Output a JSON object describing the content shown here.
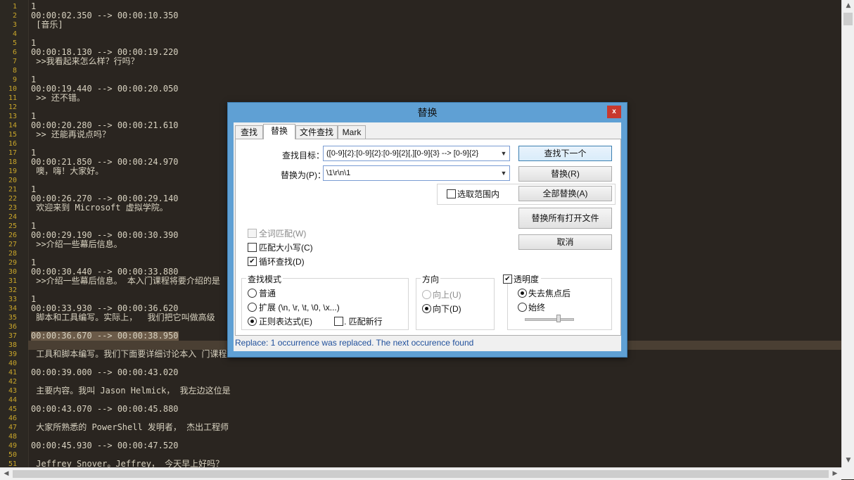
{
  "editor": {
    "lines": [
      {
        "n": "1",
        "text": "1"
      },
      {
        "n": "2",
        "text": "00:00:02.350 --> 00:00:10.350"
      },
      {
        "n": "3",
        "text": " [音乐]"
      },
      {
        "n": "4",
        "text": ""
      },
      {
        "n": "5",
        "text": "1"
      },
      {
        "n": "6",
        "text": "00:00:18.130 --> 00:00:19.220"
      },
      {
        "n": "7",
        "text": " >>我看起来怎么样？行吗？"
      },
      {
        "n": "8",
        "text": ""
      },
      {
        "n": "9",
        "text": "1"
      },
      {
        "n": "10",
        "text": "00:00:19.440 --> 00:00:20.050"
      },
      {
        "n": "11",
        "text": " >> 还不错。"
      },
      {
        "n": "12",
        "text": ""
      },
      {
        "n": "13",
        "text": "1"
      },
      {
        "n": "14",
        "text": "00:00:20.280 --> 00:00:21.610"
      },
      {
        "n": "15",
        "text": " >> 还能再说点吗？"
      },
      {
        "n": "16",
        "text": ""
      },
      {
        "n": "17",
        "text": "1"
      },
      {
        "n": "18",
        "text": "00:00:21.850 --> 00:00:24.970"
      },
      {
        "n": "19",
        "text": " 噢，嗨！大家好。"
      },
      {
        "n": "20",
        "text": ""
      },
      {
        "n": "21",
        "text": "1"
      },
      {
        "n": "22",
        "text": "00:00:26.270 --> 00:00:29.140"
      },
      {
        "n": "23",
        "text": " 欢迎来到 Microsoft 虚拟学院。"
      },
      {
        "n": "24",
        "text": ""
      },
      {
        "n": "25",
        "text": "1"
      },
      {
        "n": "26",
        "text": "00:00:29.190 --> 00:00:30.390"
      },
      {
        "n": "27",
        "text": " >>介绍一些幕后信息。"
      },
      {
        "n": "28",
        "text": ""
      },
      {
        "n": "29",
        "text": "1"
      },
      {
        "n": "30",
        "text": "00:00:30.440 --> 00:00:33.880"
      },
      {
        "n": "31",
        "text": " >>介绍一些幕后信息。 本入门课程将要介绍的是"
      },
      {
        "n": "32",
        "text": ""
      },
      {
        "n": "33",
        "text": "1"
      },
      {
        "n": "34",
        "text": "00:00:33.930 --> 00:00:36.620"
      },
      {
        "n": "35",
        "text": " 脚本和工具编写。实际上，  我们把它叫做高级"
      },
      {
        "n": "36",
        "text": ""
      },
      {
        "n": "37",
        "text": "00:00:36.670 --> 00:00:38.950"
      },
      {
        "n": "38",
        "text": ""
      },
      {
        "n": "39",
        "text": " 工具和脚本编写。我们下面要详细讨论本入 门课程"
      },
      {
        "n": "40",
        "text": ""
      },
      {
        "n": "41",
        "text": "00:00:39.000 --> 00:00:43.020"
      },
      {
        "n": "42",
        "text": ""
      },
      {
        "n": "43",
        "text": " 主要内容。我叫 Jason Helmick， 我左边这位是"
      },
      {
        "n": "44",
        "text": ""
      },
      {
        "n": "45",
        "text": "00:00:43.070 --> 00:00:45.880"
      },
      {
        "n": "46",
        "text": ""
      },
      {
        "n": "47",
        "text": " 大家所熟悉的 PowerShell 发明者， 杰出工程师"
      },
      {
        "n": "48",
        "text": ""
      },
      {
        "n": "49",
        "text": "00:00:45.930 --> 00:00:47.520"
      },
      {
        "n": "50",
        "text": ""
      },
      {
        "n": "51",
        "text": " Jeffrey Snover。Jeffrey， 今天早上好吗？"
      }
    ]
  },
  "dialog": {
    "title": "替换",
    "close": "x",
    "tabs": [
      "查找",
      "替换",
      "文件查找",
      "Mark"
    ],
    "find_label": "查找目标：",
    "find_value": "([0-9]{2}:[0-9]{2}:[0-9]{2}[,][0-9]{3} --> [0-9]{2}",
    "replace_label": "替换为(P)：",
    "replace_value": "\\1\\r\\n\\1",
    "btn_find_next": "查找下一个",
    "btn_replace": "替换(R)",
    "in_selection": "选取范围内",
    "btn_replace_all": "全部替换(A)",
    "btn_replace_all_open": "替换所有打开文件",
    "btn_cancel": "取消",
    "opt_whole_word": "全词匹配(W)",
    "opt_match_case": "匹配大小写(C)",
    "opt_wrap": "循环查找(D)",
    "search_mode_title": "查找模式",
    "mode_normal": "普通",
    "mode_extended": "扩展 (\\n, \\r, \\t, \\0, \\x...)",
    "mode_regex": "正则表达式(E)",
    "dot_newline": ". 匹配新行",
    "direction_title": "方向",
    "dir_up": "向上(U)",
    "dir_down": "向下(D)",
    "transparency_title": "透明度",
    "trans_on_lose_focus": "失去焦点后",
    "trans_always": "始终",
    "status": "Replace: 1 occurrence was replaced. The next occurence found"
  },
  "colors": {
    "editor_bg": "#2a2520",
    "line_number": "#c9a62a",
    "text": "#d8d2c0",
    "status_text": "#1f4f9b",
    "dialog_frame": "#5fa0d4"
  }
}
